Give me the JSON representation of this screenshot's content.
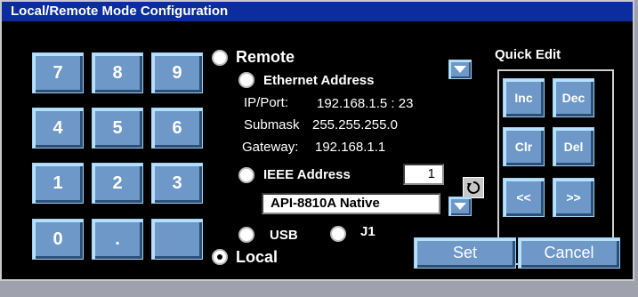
{
  "window": {
    "title": "Local/Remote Mode Configuration"
  },
  "keypad": {
    "keys": [
      "7",
      "8",
      "9",
      "4",
      "5",
      "6",
      "1",
      "2",
      "3",
      "0",
      ".",
      ""
    ]
  },
  "remote": {
    "label": "Remote",
    "ethernet": {
      "label": "Ethernet Address",
      "ip_label": "IP/Port:",
      "ip_value": "192.168.1.5 : 23",
      "submask_label": "Submask",
      "submask_value": "255.255.255.0",
      "gateway_label": "Gateway:",
      "gateway_value": "192.168.1.1"
    },
    "ieee": {
      "label": "IEEE Address",
      "value": "1"
    },
    "protocol": {
      "value": "API-8810A Native"
    },
    "usb_label": "USB",
    "j1_label": "J1"
  },
  "local": {
    "label": "Local",
    "selected": true
  },
  "quick_edit": {
    "title": "Quick Edit",
    "inc": "Inc",
    "dec": "Dec",
    "clr": "Clr",
    "del": "Del",
    "left": "<<",
    "right": ">>"
  },
  "actions": {
    "set": "Set",
    "cancel": "Cancel"
  },
  "colors": {
    "title_bar": "#0b2d9e",
    "button": "#6d98c7",
    "background": "#000000"
  },
  "icons": {
    "dropdown": "chevron-down-icon",
    "refresh": "refresh-icon"
  }
}
